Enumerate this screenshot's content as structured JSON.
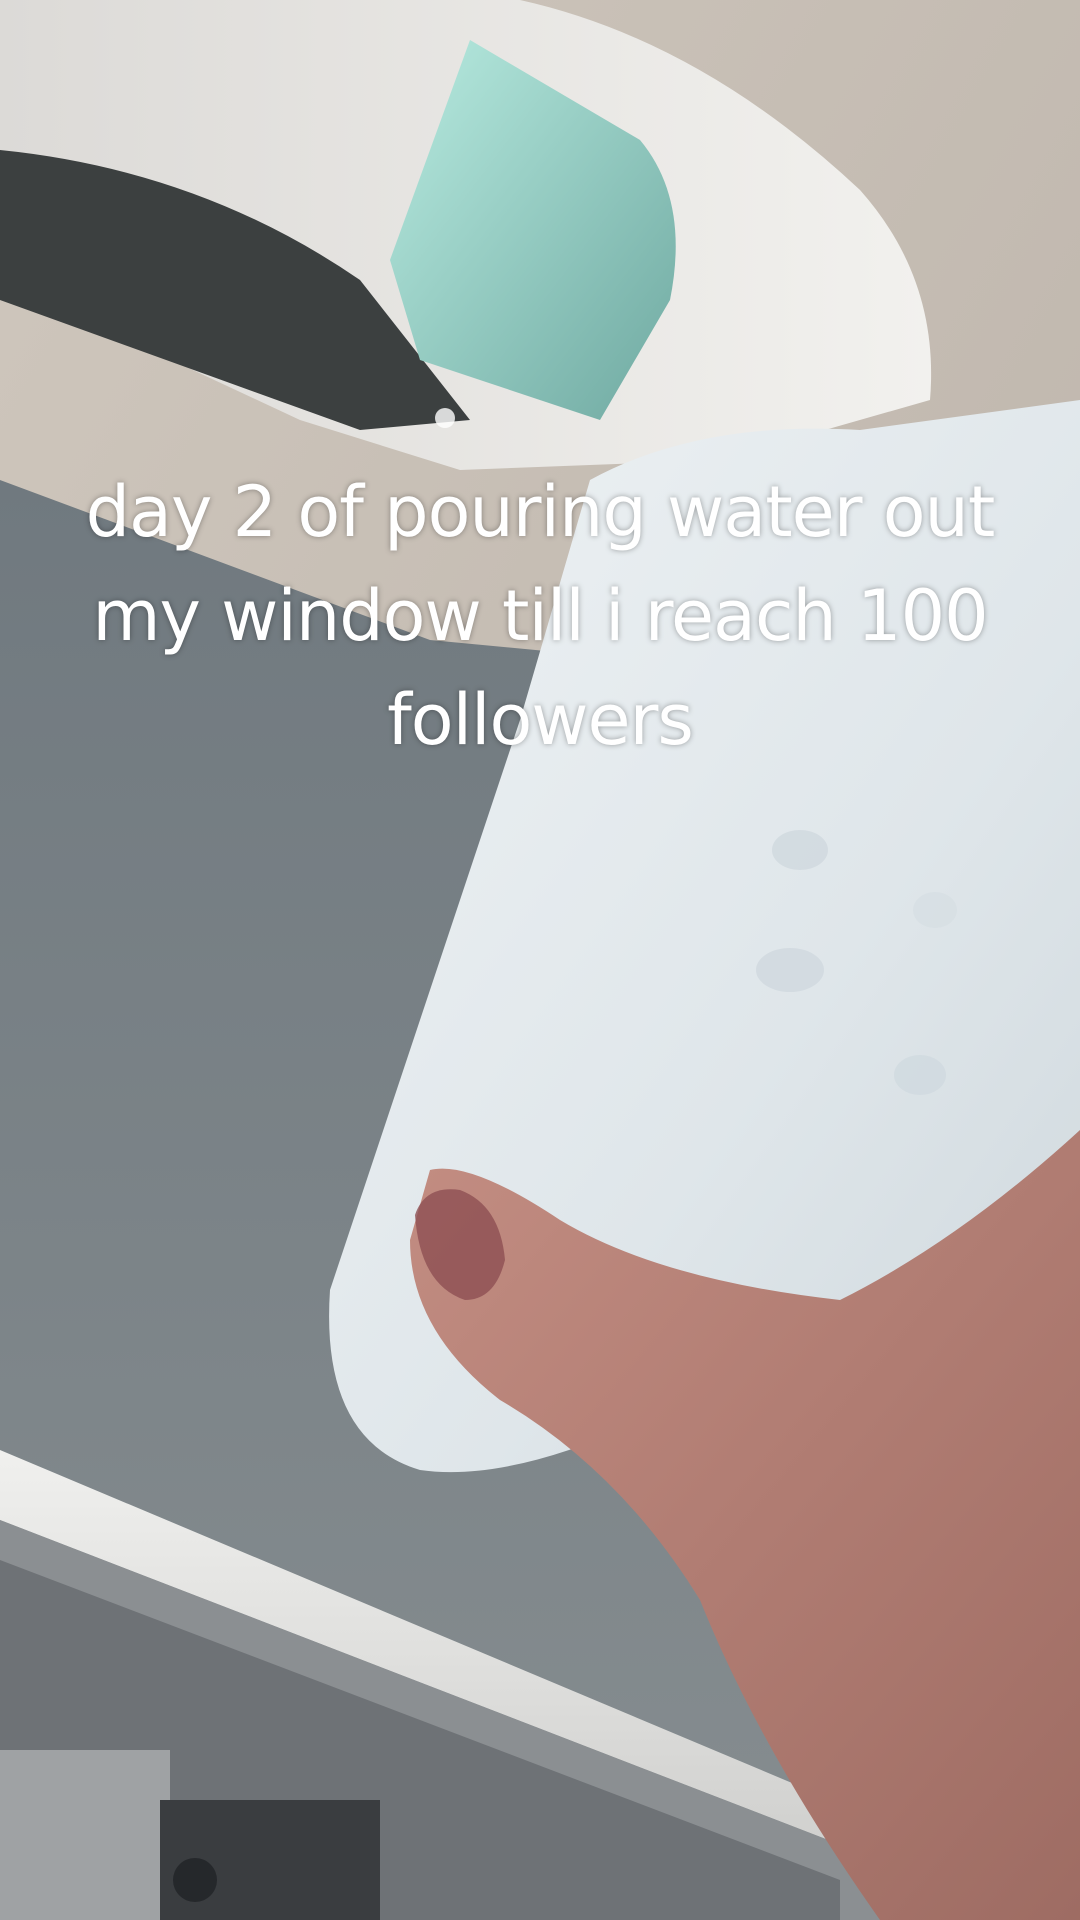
{
  "video": {
    "caption": "day 2 of pouring water out\nmy window till i reach 100\nfollowers"
  },
  "colors": {
    "caption_text": "#ffffff",
    "asphalt": "#7d858a",
    "ground_sunlit": "#c9c1b8",
    "car_body": "#e8e6e3",
    "car_glass": "#9fd6cc",
    "bottle": "#e6ecf0",
    "hand_skin": "#b27e73"
  }
}
